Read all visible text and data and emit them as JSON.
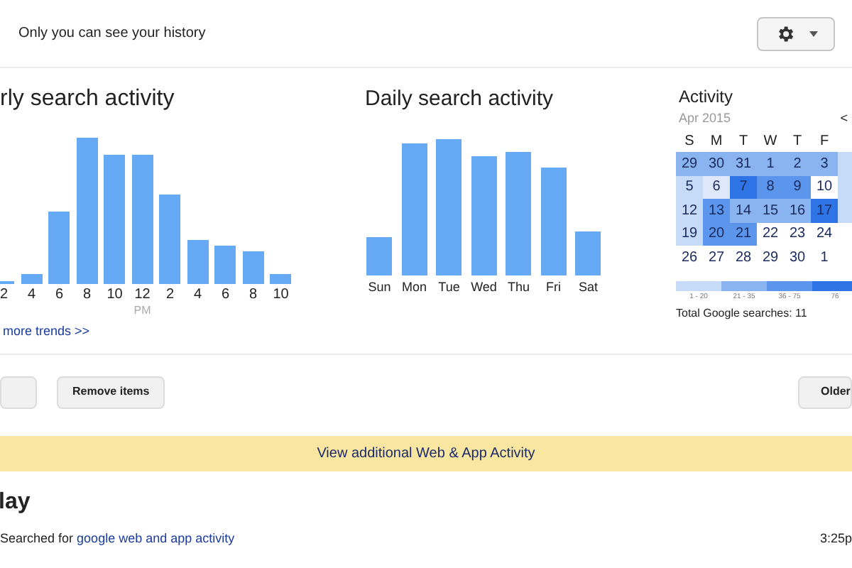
{
  "header": {
    "privacy_note": "Only you can see your history"
  },
  "hourly_activity": {
    "title": "rly search activity",
    "x_labels": [
      "2",
      "4",
      "6",
      "8",
      "10",
      "12",
      "2",
      "4",
      "6",
      "8",
      "10"
    ],
    "period_label": "PM",
    "link": "more trends >>"
  },
  "daily_activity": {
    "title": "Daily search activity",
    "x_labels": [
      "Sun",
      "Mon",
      "Tue",
      "Wed",
      "Thu",
      "Fri",
      "Sat"
    ]
  },
  "calendar": {
    "title": "Activity",
    "month": "Apr 2015",
    "nav": "<",
    "weekdays": [
      "S",
      "M",
      "T",
      "W",
      "T",
      "F"
    ],
    "weeks": [
      [
        {
          "day": "29",
          "color": "#8ab4f0"
        },
        {
          "day": "30",
          "color": "#8ab4f0"
        },
        {
          "day": "31",
          "color": "#8ab4f0"
        },
        {
          "day": "1",
          "color": "#8ab4f0"
        },
        {
          "day": "2",
          "color": "#8ab4f0"
        },
        {
          "day": "3",
          "color": "#8ab4f0"
        },
        {
          "color": "#c6dbf7"
        }
      ],
      [
        {
          "day": "5",
          "color": "#c6dbf7"
        },
        {
          "day": "6",
          "color": "#dde9fa"
        },
        {
          "day": "7",
          "color": "#2f74e6"
        },
        {
          "day": "8",
          "color": "#5b95ec"
        },
        {
          "day": "9",
          "color": "#5b95ec"
        },
        {
          "day": "10",
          "color": "#ffffff"
        },
        {
          "color": "#c6dbf7"
        }
      ],
      [
        {
          "day": "12",
          "color": "#c6dbf7"
        },
        {
          "day": "13",
          "color": "#5b95ec"
        },
        {
          "day": "14",
          "color": "#8ab4f0"
        },
        {
          "day": "15",
          "color": "#8ab4f0"
        },
        {
          "day": "16",
          "color": "#8ab4f0"
        },
        {
          "day": "17",
          "color": "#2f74e6"
        },
        {
          "color": "#c6dbf7"
        }
      ],
      [
        {
          "day": "19",
          "color": "#c6dbf7"
        },
        {
          "day": "20",
          "color": "#5b95ec"
        },
        {
          "day": "21",
          "color": "#5b95ec"
        },
        {
          "day": "22",
          "color": "#ffffff"
        },
        {
          "day": "23",
          "color": "#ffffff"
        },
        {
          "day": "24",
          "color": "#ffffff"
        }
      ],
      [
        {
          "day": "26",
          "color": "#ffffff"
        },
        {
          "day": "27",
          "color": "#ffffff"
        },
        {
          "day": "28",
          "color": "#ffffff"
        },
        {
          "day": "29",
          "color": "#ffffff"
        },
        {
          "day": "30",
          "color": "#ffffff"
        },
        {
          "day": "1",
          "color": "#ffffff"
        }
      ]
    ],
    "legend": [
      {
        "label": "1 - 20",
        "color": "#c6dbf7"
      },
      {
        "label": "21 - 35",
        "color": "#8ab4f0"
      },
      {
        "label": "36 - 75",
        "color": "#5b95ec"
      },
      {
        "label": "76",
        "color": "#2f74e6"
      }
    ],
    "total": "Total Google searches: 11"
  },
  "actions": {
    "buttons": [
      "Remove items"
    ],
    "older": "Older"
  },
  "banner": {
    "link": "View additional Web & App Activity"
  },
  "day_heading": "lay",
  "entries": [
    {
      "prefix": "Searched for",
      "query": "google web and app activity",
      "time": "3:25p"
    }
  ]
}
